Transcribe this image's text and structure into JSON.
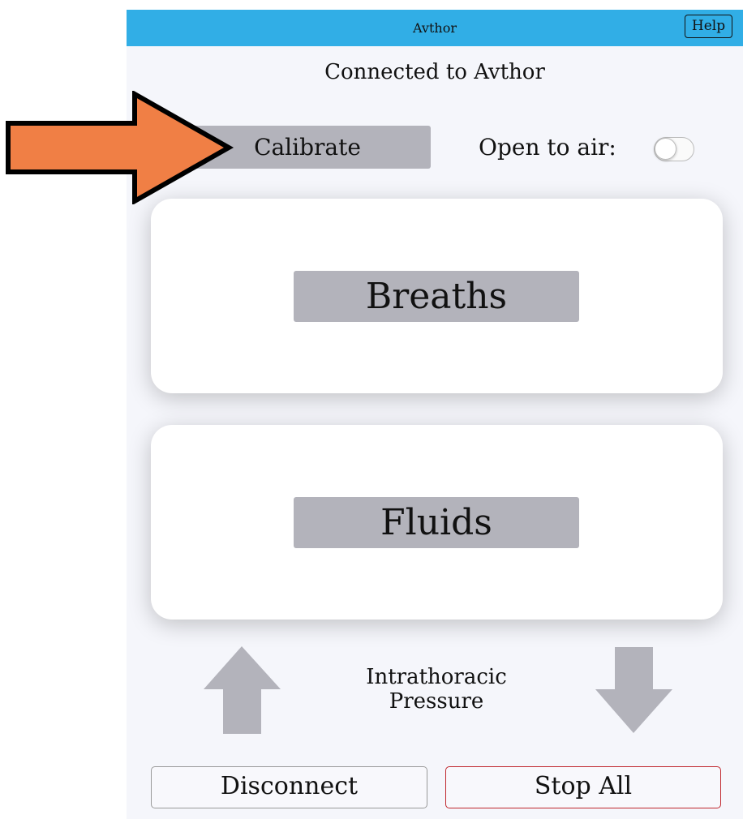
{
  "window": {
    "title": "Avthor",
    "help_label": "Help"
  },
  "status": {
    "text": "Connected to Avthor"
  },
  "controls": {
    "calibrate_label": "Calibrate",
    "open_to_air_label": "Open to air:",
    "open_to_air_on": false
  },
  "cards": {
    "breaths_label": "Breaths",
    "fluids_label": "Fluids"
  },
  "pressure": {
    "line1": "Intrathoracic",
    "line2": "Pressure"
  },
  "footer": {
    "disconnect_label": "Disconnect",
    "stop_all_label": "Stop All"
  },
  "icons": {
    "increase": "arrow-up-icon",
    "decrease": "arrow-down-icon",
    "callout": "callout-arrow-icon"
  },
  "colors": {
    "titlebar": "#31aee6",
    "button_gray": "#b3b3bb",
    "stop_border": "#c0272d",
    "callout_arrow": "#f07f45"
  }
}
